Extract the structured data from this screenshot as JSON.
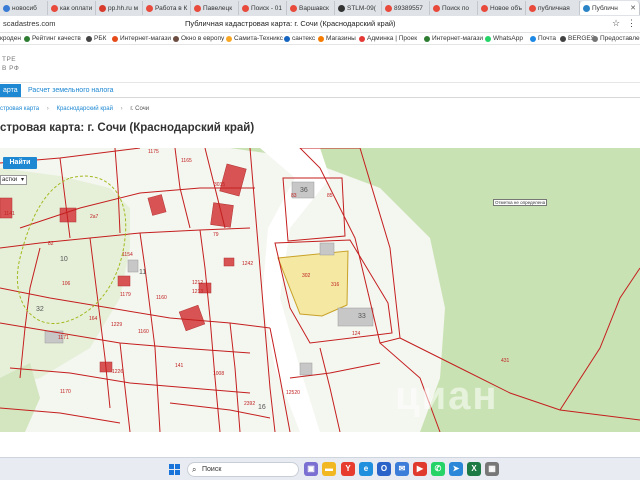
{
  "browser": {
    "tabs": [
      {
        "label": "новосиб",
        "color": "#3a7bd5"
      },
      {
        "label": "как оплати",
        "color": "#e84a3c"
      },
      {
        "label": "pp.hh.ru м",
        "color": "#d83a2b"
      },
      {
        "label": "Работа в К",
        "color": "#e84a3c"
      },
      {
        "label": "Павелецк",
        "color": "#e84a3c"
      },
      {
        "label": "Поиск - 01",
        "color": "#e84a3c"
      },
      {
        "label": "Варшавск",
        "color": "#e84a3c"
      },
      {
        "label": "STLM-09(",
        "color": "#333333"
      },
      {
        "label": "89389557",
        "color": "#e84a3c"
      },
      {
        "label": "Поиск по",
        "color": "#e84a3c"
      },
      {
        "label": "Новое объ",
        "color": "#e84a3c"
      },
      {
        "label": "публичная",
        "color": "#e84a3c"
      },
      {
        "label": "Публичн",
        "color": "#2b84c6",
        "active": true
      }
    ],
    "url": "scadastres.com",
    "page_title": "Публичная кадастровая карта: г. Сочи (Краснодарский край)",
    "bookmarks": [
      {
        "label": "кроден",
        "color": "#888888"
      },
      {
        "label": "Рейтинг качеств",
        "color": "#2e7d32"
      },
      {
        "label": "РБК",
        "color": "#444444"
      },
      {
        "label": "Интернет-магази",
        "color": "#e64a19"
      },
      {
        "label": "Окно в европу",
        "color": "#6d4c41"
      },
      {
        "label": "Самита-Техникс",
        "color": "#f9a825"
      },
      {
        "label": "сантекс",
        "color": "#1565c0"
      },
      {
        "label": "Магазины",
        "color": "#f57c00"
      },
      {
        "label": "Админка | Проек",
        "color": "#e53935"
      },
      {
        "label": "Интернет-магази",
        "color": "#2e7d32"
      },
      {
        "label": "WhatsApp",
        "color": "#25d366"
      },
      {
        "label": "Почта",
        "color": "#1e88e5"
      },
      {
        "label": "BERGES",
        "color": "#424242"
      },
      {
        "label": "Предоставле",
        "color": "#757575"
      }
    ]
  },
  "site": {
    "logo_line1": "ТРЕ",
    "logo_line2": "В РФ",
    "nav_active": "арта",
    "nav_other": "Расчет земельного налога",
    "breadcrumbs": [
      "стровая карта",
      "Краснодарский край",
      "г. Сочи"
    ],
    "heading": "стровая карта: г. Сочи (Краснодарский край)"
  },
  "map": {
    "find_button": "Найти",
    "select_value": "астки",
    "poi_label": "Отметка не определена",
    "watermark": "циан",
    "labels": [
      {
        "t": "1175",
        "k": "r"
      },
      {
        "t": "1165",
        "k": "r"
      },
      {
        "t": "3035",
        "k": "r"
      },
      {
        "t": "36",
        "k": "b"
      },
      {
        "t": "83",
        "k": "r"
      },
      {
        "t": "85",
        "k": "r"
      },
      {
        "t": "1141",
        "k": "r"
      },
      {
        "t": "2a7",
        "k": "r"
      },
      {
        "t": "82",
        "k": "r"
      },
      {
        "t": "10",
        "k": "b"
      },
      {
        "t": "79",
        "k": "r"
      },
      {
        "t": "1154",
        "k": "r"
      },
      {
        "t": "11",
        "k": "b"
      },
      {
        "t": "1242",
        "k": "r"
      },
      {
        "t": "302",
        "k": "r"
      },
      {
        "t": "316",
        "k": "r"
      },
      {
        "t": "106",
        "k": "r"
      },
      {
        "t": "1212",
        "k": "r"
      },
      {
        "t": "1213",
        "k": "r"
      },
      {
        "t": "1160",
        "k": "r"
      },
      {
        "t": "1179",
        "k": "r"
      },
      {
        "t": "32",
        "k": "b"
      },
      {
        "t": "164",
        "k": "r"
      },
      {
        "t": "1229",
        "k": "r"
      },
      {
        "t": "33",
        "k": "b"
      },
      {
        "t": "124",
        "k": "r"
      },
      {
        "t": "1160",
        "k": "r"
      },
      {
        "t": "1171",
        "k": "r"
      },
      {
        "t": "141",
        "k": "r"
      },
      {
        "t": "1226",
        "k": "r"
      },
      {
        "t": "1008",
        "k": "r"
      },
      {
        "t": "431",
        "k": "r"
      },
      {
        "t": "12520",
        "k": "r"
      },
      {
        "t": "1170",
        "k": "r"
      },
      {
        "t": "2392",
        "k": "r"
      },
      {
        "t": "16",
        "k": "b"
      }
    ]
  },
  "taskbar": {
    "search_placeholder": "Поиск"
  }
}
